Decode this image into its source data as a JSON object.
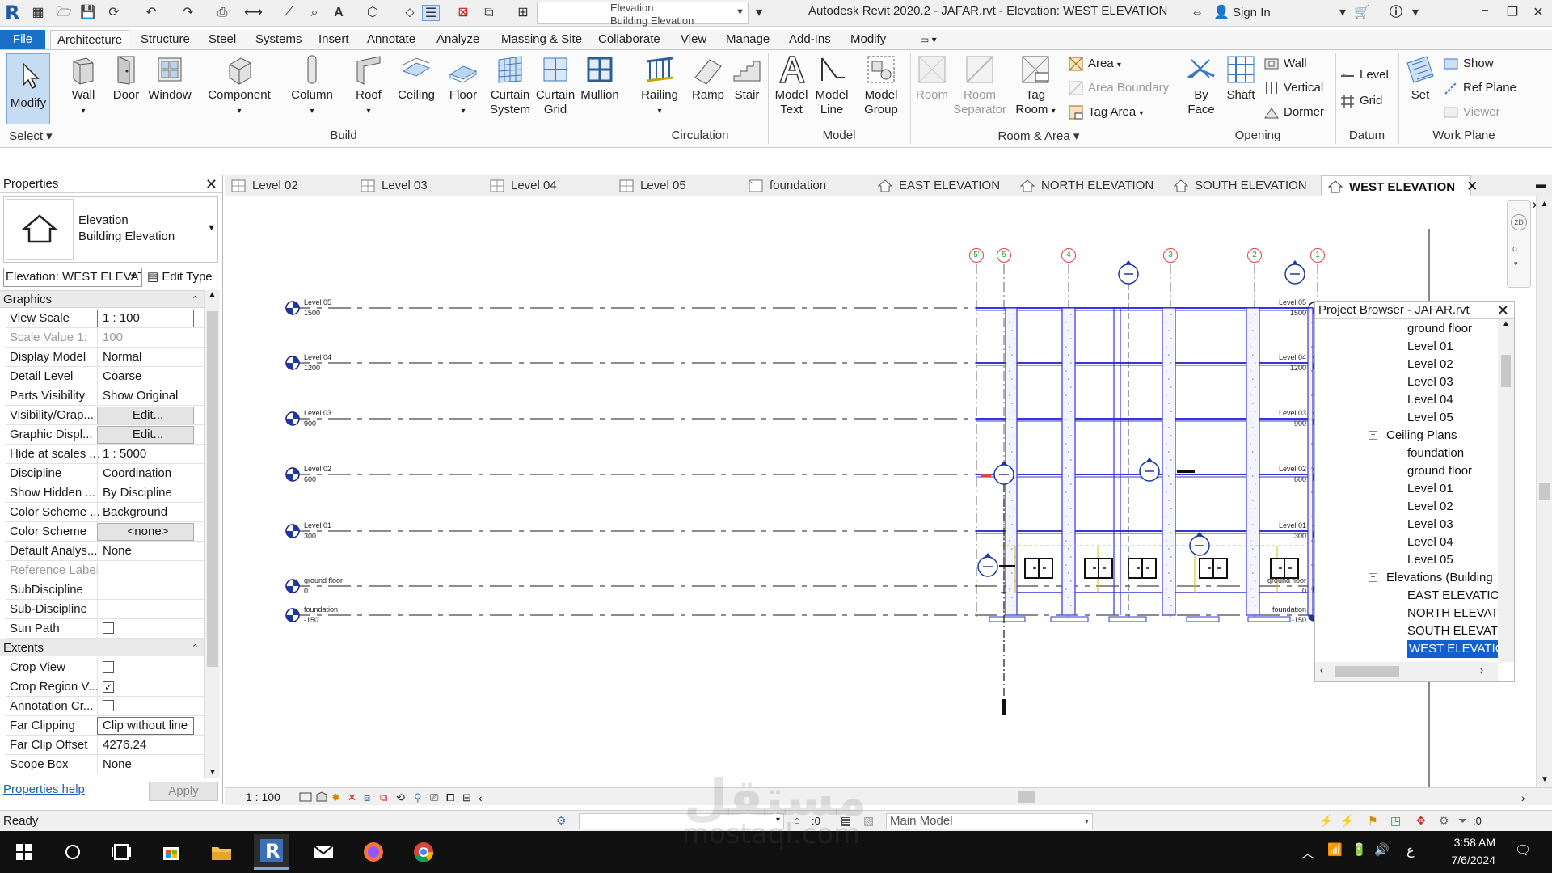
{
  "title_bar": {
    "app_title": "Autodesk Revit 2020.2 - JAFAR.rvt - Elevation: WEST ELEVATION",
    "type_selector_line1": "Elevation",
    "type_selector_line2": "Building Elevation",
    "sign_in": "Sign In",
    "app_logo": "R"
  },
  "ribbon_tabs": [
    "File",
    "Architecture",
    "Structure",
    "Steel",
    "Systems",
    "Insert",
    "Annotate",
    "Analyze",
    "Massing & Site",
    "Collaborate",
    "View",
    "Manage",
    "Add-Ins",
    "Modify"
  ],
  "ribbon": {
    "select": {
      "modify": "Modify",
      "select_label": "Select"
    },
    "build": {
      "label": "Build",
      "wall": "Wall",
      "door": "Door",
      "window": "Window",
      "component": "Component",
      "column": "Column",
      "roof": "Roof",
      "ceiling": "Ceiling",
      "floor": "Floor",
      "curtain_system_1": "Curtain",
      "curtain_system_2": "System",
      "curtain_grid_1": "Curtain",
      "curtain_grid_2": "Grid",
      "mullion": "Mullion"
    },
    "circulation": {
      "label": "Circulation",
      "railing": "Railing",
      "ramp": "Ramp",
      "stair": "Stair"
    },
    "model": {
      "label": "Model",
      "model_text_1": "Model",
      "model_text_2": "Text",
      "model_line_1": "Model",
      "model_line_2": "Line",
      "model_group_1": "Model",
      "model_group_2": "Group"
    },
    "room_area": {
      "label": "Room & Area",
      "room": "Room",
      "room_sep_1": "Room",
      "room_sep_2": "Separator",
      "tag_room_1": "Tag",
      "tag_room_2": "Room",
      "area": "Area",
      "area_boundary": "Area  Boundary",
      "tag_area": "Tag  Area"
    },
    "opening": {
      "label": "Opening",
      "by_face_1": "By",
      "by_face_2": "Face",
      "shaft": "Shaft",
      "wall": "Wall",
      "vertical": "Vertical",
      "dormer": "Dormer"
    },
    "datum": {
      "label": "Datum",
      "level": "Level",
      "grid": "Grid"
    },
    "work_plane": {
      "label": "Work Plane",
      "set": "Set",
      "show": "Show",
      "ref_plane": "Ref  Plane",
      "viewer": "Viewer"
    }
  },
  "properties": {
    "title": "Properties",
    "type_line1": "Elevation",
    "type_line2": "Building Elevation",
    "instance": "Elevation: WEST ELEVATION",
    "edit_type": "Edit Type",
    "groups": {
      "graphics": "Graphics",
      "extents": "Extents"
    },
    "rows": [
      {
        "name": "View Scale",
        "value": "1 : 100"
      },
      {
        "name": "Scale Value    1:",
        "value": "100"
      },
      {
        "name": "Display Model",
        "value": "Normal"
      },
      {
        "name": "Detail Level",
        "value": "Coarse"
      },
      {
        "name": "Parts Visibility",
        "value": "Show Original"
      },
      {
        "name": "Visibility/Grap...",
        "value": "Edit..."
      },
      {
        "name": "Graphic Displ...",
        "value": "Edit..."
      },
      {
        "name": "Hide at scales ...",
        "value": "1 : 5000"
      },
      {
        "name": "Discipline",
        "value": "Coordination"
      },
      {
        "name": "Show Hidden ...",
        "value": "By Discipline"
      },
      {
        "name": "Color Scheme ...",
        "value": "Background"
      },
      {
        "name": "Color Scheme",
        "value": "<none>"
      },
      {
        "name": "Default Analys...",
        "value": "None"
      },
      {
        "name": "Reference Label",
        "value": ""
      },
      {
        "name": "SubDiscipline",
        "value": ""
      },
      {
        "name": "Sub-Discipline",
        "value": ""
      },
      {
        "name": "Sun Path",
        "value": ""
      }
    ],
    "extent_rows": [
      {
        "name": "Crop View",
        "value": ""
      },
      {
        "name": "Crop Region V...",
        "value": "✓"
      },
      {
        "name": "Annotation Cr...",
        "value": ""
      },
      {
        "name": "Far Clipping",
        "value": "Clip without line"
      },
      {
        "name": "Far Clip Offset",
        "value": "4276.24"
      },
      {
        "name": "Scope Box",
        "value": "None"
      }
    ],
    "help": "Properties help",
    "apply": "Apply"
  },
  "view_tabs": [
    {
      "label": "Level 02"
    },
    {
      "label": "Level 03"
    },
    {
      "label": "Level 04"
    },
    {
      "label": "Level 05"
    },
    {
      "label": "foundation"
    },
    {
      "label": "EAST ELEVATION"
    },
    {
      "label": "NORTH ELEVATION"
    },
    {
      "label": "SOUTH ELEVATION"
    },
    {
      "label": "WEST ELEVATION"
    }
  ],
  "drawing": {
    "levels": [
      {
        "name": "Level 05",
        "elev": "1500"
      },
      {
        "name": "Level 04",
        "elev": "1200"
      },
      {
        "name": "Level 03",
        "elev": "900"
      },
      {
        "name": "Level 02",
        "elev": "600"
      },
      {
        "name": "Level 01",
        "elev": "300"
      },
      {
        "name": "ground floor",
        "elev": "0"
      },
      {
        "name": "foundation",
        "elev": "-150"
      }
    ],
    "grids": [
      "5'",
      "5",
      "4",
      "3",
      "2",
      "1"
    ]
  },
  "project_browser": {
    "title": "Project Browser - JAFAR.rvt",
    "items": [
      {
        "label": "ground floor",
        "indent": 2
      },
      {
        "label": "Level 01",
        "indent": 2
      },
      {
        "label": "Level 02",
        "indent": 2
      },
      {
        "label": "Level 03",
        "indent": 2
      },
      {
        "label": "Level 04",
        "indent": 2
      },
      {
        "label": "Level 05",
        "indent": 2
      },
      {
        "label": "Ceiling Plans",
        "indent": 1
      },
      {
        "label": "foundation",
        "indent": 2
      },
      {
        "label": "ground floor",
        "indent": 2
      },
      {
        "label": "Level 01",
        "indent": 2
      },
      {
        "label": "Level 02",
        "indent": 2
      },
      {
        "label": "Level 03",
        "indent": 2
      },
      {
        "label": "Level 04",
        "indent": 2
      },
      {
        "label": "Level 05",
        "indent": 2
      },
      {
        "label": "Elevations (Building Elevation)",
        "indent": 1
      },
      {
        "label": "EAST ELEVATION",
        "indent": 2
      },
      {
        "label": "NORTH ELEVATION",
        "indent": 2
      },
      {
        "label": "SOUTH ELEVATION",
        "indent": 2
      },
      {
        "label": "WEST ELEVATION",
        "indent": 2
      }
    ]
  },
  "view_bar": {
    "scale": "1 : 100"
  },
  "status_bar": {
    "status": "Ready",
    "selection_count": ":0",
    "model": "Main Model",
    "filter_count": ":0"
  },
  "taskbar": {
    "time": "3:58 AM",
    "date": "7/6/2024",
    "lang": "ع"
  },
  "watermark": {
    "arabic": "مستقل",
    "latin": "mostaql.com"
  },
  "colors": {
    "accent": "#1a6fc6",
    "selection": "#1060d0",
    "level_line": "#1a1a1a",
    "structure": "#3535d8",
    "grid_bubble": "#e0443e",
    "grid_text": "#2aa14a"
  }
}
